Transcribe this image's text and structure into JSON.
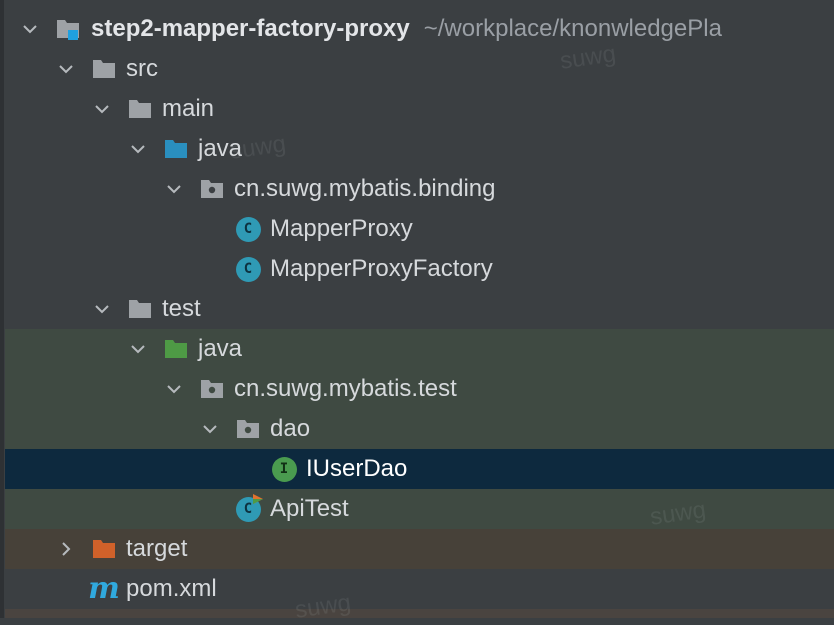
{
  "rows": [
    {
      "label": "step2-mapper-factory-proxy",
      "path": "~/workplace/knonwledgePla",
      "icon": "module-folder-icon",
      "expanded": true
    },
    {
      "label": "src",
      "icon": "folder-icon",
      "expanded": true
    },
    {
      "label": "main",
      "icon": "folder-icon",
      "expanded": true
    },
    {
      "label": "java",
      "icon": "source-root-folder-icon",
      "expanded": true
    },
    {
      "label": "cn.suwg.mybatis.binding",
      "icon": "package-icon",
      "expanded": true
    },
    {
      "label": "MapperProxy",
      "icon": "class-icon"
    },
    {
      "label": "MapperProxyFactory",
      "icon": "class-icon"
    },
    {
      "label": "test",
      "icon": "folder-icon",
      "expanded": true
    },
    {
      "label": "java",
      "icon": "test-root-folder-icon",
      "expanded": true
    },
    {
      "label": "cn.suwg.mybatis.test",
      "icon": "package-icon",
      "expanded": true
    },
    {
      "label": "dao",
      "icon": "package-icon",
      "expanded": true
    },
    {
      "label": "IUserDao",
      "icon": "interface-icon",
      "selected": true
    },
    {
      "label": "ApiTest",
      "icon": "test-class-icon"
    },
    {
      "label": "target",
      "icon": "excluded-folder-icon",
      "expanded": false
    },
    {
      "label": "pom.xml",
      "icon": "maven-icon"
    }
  ],
  "glyphs": {
    "class": "C",
    "interface": "I",
    "maven": "m"
  },
  "watermarks": [
    "suwg",
    "suwg",
    "suwg",
    "suwg"
  ],
  "colors": {
    "background": "#3b3f42",
    "test_bg": "#3f4a42",
    "selection": "#0d293e",
    "excluded_bg": "#474139",
    "source_folder": "#2a8fbf",
    "test_folder": "#4e9a45",
    "excluded_folder": "#d0612a",
    "class_icon": "#2f9ab5",
    "interface_icon": "#4a9b4f"
  }
}
